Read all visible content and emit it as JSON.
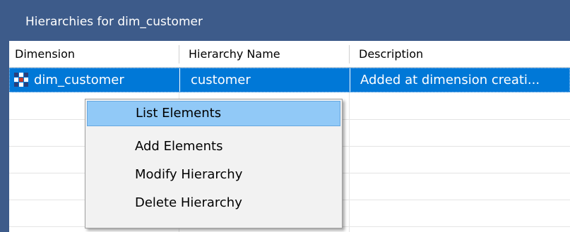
{
  "window": {
    "title": "Hierarchies for dim_customer"
  },
  "grid": {
    "columns": [
      "Dimension",
      "Hierarchy Name",
      "Description"
    ],
    "rows": [
      {
        "dimension": "dim_customer",
        "hierarchy_name": "customer",
        "description": "Added at dimension creati...",
        "selected": true,
        "icon": "dimension-icon"
      }
    ]
  },
  "context_menu": {
    "items": [
      "List Elements",
      "Add Elements",
      "Modify Hierarchy",
      "Delete Hierarchy"
    ],
    "highlighted": "List Elements"
  },
  "colors": {
    "title_bar": "#3d5b8a",
    "selection": "#0078d7",
    "menu_highlight": "#91c9f7",
    "menu_background": "#f2f2f2"
  }
}
